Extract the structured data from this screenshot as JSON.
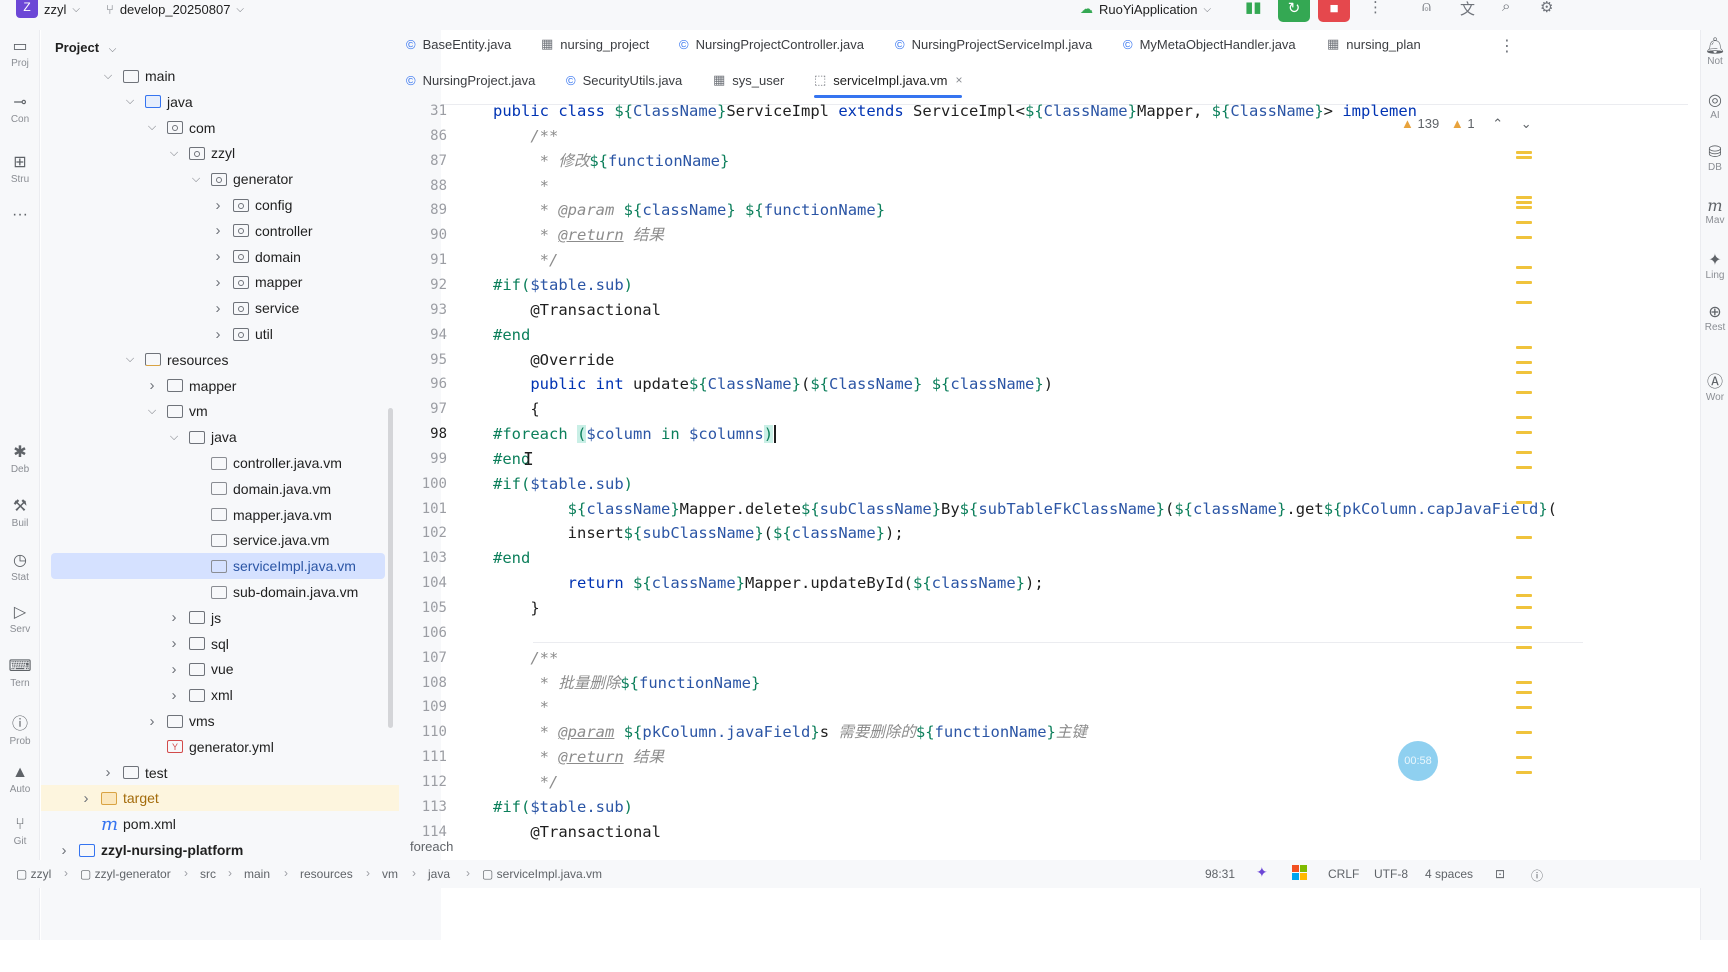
{
  "titlebar": {
    "project_badge": "Z",
    "project_name": "zzyl",
    "branch": "develop_20250807",
    "run_config": "RuoYiApplication",
    "colors": {
      "run_green": "#34a853",
      "stop_red": "#e5484d",
      "badge_purple": "#6c47d6"
    }
  },
  "left_strip": [
    {
      "icon": "folder-icon",
      "glyph": "▭",
      "label": "Proj"
    },
    {
      "icon": "commit-icon",
      "glyph": "⊸",
      "label": "Con"
    },
    {
      "icon": "structure-icon",
      "glyph": "⊞",
      "label": "Stru"
    },
    {
      "icon": "more-icon",
      "glyph": "···",
      "label": ""
    },
    {
      "icon": "debug-icon",
      "glyph": "✱",
      "label": "Deb"
    },
    {
      "icon": "build-icon",
      "glyph": "⚒",
      "label": "Buil"
    },
    {
      "icon": "stats-icon",
      "glyph": "◷",
      "label": "Stat"
    },
    {
      "icon": "services-icon",
      "glyph": "▷",
      "label": "Serv"
    },
    {
      "icon": "terminal-icon",
      "glyph": "⌨",
      "label": "Tern"
    },
    {
      "icon": "problems-icon",
      "glyph": "ⓘ",
      "label": "Prob"
    },
    {
      "icon": "warning-icon",
      "glyph": "▲",
      "label": "Auto"
    },
    {
      "icon": "git-icon",
      "glyph": "⑂",
      "label": "Git"
    }
  ],
  "project_panel": {
    "title": "Project",
    "tree": [
      {
        "label": "main",
        "type": "folder",
        "depth": 0,
        "expanded": true
      },
      {
        "label": "java",
        "type": "folder-blue",
        "depth": 1,
        "expanded": true
      },
      {
        "label": "com",
        "type": "package",
        "depth": 2,
        "expanded": true
      },
      {
        "label": "zzyl",
        "type": "package",
        "depth": 3,
        "expanded": true
      },
      {
        "label": "generator",
        "type": "package",
        "depth": 4,
        "expanded": true
      },
      {
        "label": "config",
        "type": "package",
        "depth": 5,
        "expanded": false
      },
      {
        "label": "controller",
        "type": "package",
        "depth": 5,
        "expanded": false
      },
      {
        "label": "domain",
        "type": "package",
        "depth": 5,
        "expanded": false
      },
      {
        "label": "mapper",
        "type": "package",
        "depth": 5,
        "expanded": false
      },
      {
        "label": "service",
        "type": "package",
        "depth": 5,
        "expanded": false
      },
      {
        "label": "util",
        "type": "package",
        "depth": 5,
        "expanded": false
      },
      {
        "label": "resources",
        "type": "folder-res",
        "depth": 1,
        "expanded": true
      },
      {
        "label": "mapper",
        "type": "folder",
        "depth": 2,
        "expanded": false
      },
      {
        "label": "vm",
        "type": "folder",
        "depth": 2,
        "expanded": true
      },
      {
        "label": "java",
        "type": "folder",
        "depth": 3,
        "expanded": true
      },
      {
        "label": "controller.java.vm",
        "type": "file",
        "depth": 4
      },
      {
        "label": "domain.java.vm",
        "type": "file",
        "depth": 4
      },
      {
        "label": "mapper.java.vm",
        "type": "file",
        "depth": 4
      },
      {
        "label": "service.java.vm",
        "type": "file",
        "depth": 4
      },
      {
        "label": "serviceImpl.java.vm",
        "type": "file",
        "depth": 4,
        "selected": true
      },
      {
        "label": "sub-domain.java.vm",
        "type": "file",
        "depth": 4
      },
      {
        "label": "js",
        "type": "folder",
        "depth": 3,
        "expanded": false
      },
      {
        "label": "sql",
        "type": "folder",
        "depth": 3,
        "expanded": false
      },
      {
        "label": "vue",
        "type": "folder",
        "depth": 3,
        "expanded": false
      },
      {
        "label": "xml",
        "type": "folder",
        "depth": 3,
        "expanded": false
      },
      {
        "label": "vms",
        "type": "folder",
        "depth": 2,
        "expanded": false
      },
      {
        "label": "generator.yml",
        "type": "yml",
        "depth": 2
      },
      {
        "label": "test",
        "type": "folder",
        "depth": 0,
        "expanded": false
      },
      {
        "label": "target",
        "type": "folder-orange",
        "depth": -1,
        "expanded": false,
        "highlight": true
      },
      {
        "label": "pom.xml",
        "type": "maven",
        "depth": -1
      },
      {
        "label": "zzyl-nursing-platform",
        "type": "module",
        "depth": -2,
        "expanded": false,
        "bold": true
      }
    ]
  },
  "tabs_row1": [
    {
      "label": "BaseEntity.java",
      "icon": "class-icon"
    },
    {
      "label": "nursing_project",
      "icon": "table-icon"
    },
    {
      "label": "NursingProjectController.java",
      "icon": "class-icon"
    },
    {
      "label": "NursingProjectServiceImpl.java",
      "icon": "class-icon"
    },
    {
      "label": "MyMetaObjectHandler.java",
      "icon": "class-icon"
    },
    {
      "label": "nursing_plan",
      "icon": "table-icon"
    }
  ],
  "tabs_row2": [
    {
      "label": "NursingProject.java",
      "icon": "class-icon"
    },
    {
      "label": "SecurityUtils.java",
      "icon": "class-icon"
    },
    {
      "label": "sys_user",
      "icon": "table-icon"
    },
    {
      "label": "serviceImpl.java.vm",
      "icon": "file-icon",
      "active": true
    }
  ],
  "editor": {
    "warnings": "139",
    "weak_warnings": "1",
    "current_line": "98",
    "lines": [
      {
        "n": "31",
        "html": "<span class='kw'>public class</span> <span class='vm'>${</span><span class='var'>ClassName</span><span class='vm'>}</span>ServiceImpl <span class='kw'>extends</span> ServiceImpl&lt;<span class='vm'>${</span><span class='var'>ClassName</span><span class='vm'>}</span>Mapper, <span class='vm'>${</span><span class='var'>ClassName</span><span class='vm'>}</span>&gt; <span class='kw'>implemen</span>"
      },
      {
        "n": "86",
        "html": "    <span class='cm'>/**</span>"
      },
      {
        "n": "87",
        "html": "     <span class='cm'>* 修改</span><span class='vm'>${</span><span class='var'>functionName</span><span class='vm'>}</span>"
      },
      {
        "n": "88",
        "html": "     <span class='cm'>*</span>"
      },
      {
        "n": "89",
        "html": "     <span class='cm'>* @param</span> <span class='vm'>${</span><span class='var'>className</span><span class='vm'>}</span> <span class='vm'>${</span><span class='var'>functionName</span><span class='vm'>}</span>"
      },
      {
        "n": "90",
        "html": "     <span class='cm'>* <u>@return</u> 结果</span>"
      },
      {
        "n": "91",
        "html": "     <span class='cm'>*/</span>"
      },
      {
        "n": "92",
        "html": "<span class='vm'>#if(</span><span class='var'>$table.sub</span><span class='vm'>)</span>"
      },
      {
        "n": "93",
        "html": "    @Transactional"
      },
      {
        "n": "94",
        "html": "<span class='vm'>#end</span>"
      },
      {
        "n": "95",
        "html": "    @Override"
      },
      {
        "n": "96",
        "html": "    <span class='kw'>public int</span> update<span class='vm'>${</span><span class='var'>ClassName</span><span class='vm'>}</span>(<span class='vm'>${</span><span class='var'>ClassName</span><span class='vm'>}</span> <span class='vm'>${</span><span class='var'>className</span><span class='vm'>}</span>)"
      },
      {
        "n": "97",
        "html": "    {"
      },
      {
        "n": "98",
        "html": "<span class='vm'>#foreach</span> <span class='hl vm'>(</span><span class='var'>$column</span> <span class='vm'>in</span> <span class='var'>$columns</span><span class='hl vm'>)</span>"
      },
      {
        "n": "99",
        "html": "<span class='vm'>#end</span>"
      },
      {
        "n": "100",
        "html": "<span class='vm'>#if(</span><span class='var'>$table.sub</span><span class='vm'>)</span>"
      },
      {
        "n": "101",
        "html": "        <span class='vm'>${</span><span class='var'>className</span><span class='vm'>}</span>Mapper.delete<span class='vm'>${</span><span class='var'>subClassName</span><span class='vm'>}</span>By<span class='vm'>${</span><span class='var'>subTableFkClassName</span><span class='vm'>}</span>(<span class='vm'>${</span><span class='var'>className</span><span class='vm'>}</span>.get<span class='vm'>${</span><span class='var'>pkColumn.capJavaField</span><span class='vm'>}</span>("
      },
      {
        "n": "102",
        "html": "        insert<span class='vm'>${</span><span class='var'>subClassName</span><span class='vm'>}</span>(<span class='vm'>${</span><span class='var'>className</span><span class='vm'>}</span>);"
      },
      {
        "n": "103",
        "html": "<span class='vm'>#end</span>"
      },
      {
        "n": "104",
        "html": "        <span class='kw'>return</span> <span class='vm'>${</span><span class='var'>className</span><span class='vm'>}</span>Mapper.updateById(<span class='vm'>${</span><span class='var'>className</span><span class='vm'>}</span>);"
      },
      {
        "n": "105",
        "html": "    }"
      },
      {
        "n": "106",
        "html": ""
      },
      {
        "n": "107",
        "html": "    <span class='cm'>/**</span>"
      },
      {
        "n": "108",
        "html": "     <span class='cm'>* 批量删除</span><span class='vm'>${</span><span class='var'>functionName</span><span class='vm'>}</span>"
      },
      {
        "n": "109",
        "html": "     <span class='cm'>*</span>"
      },
      {
        "n": "110",
        "html": "     <span class='cm'>* <u>@param</u></span> <span class='vm'>${</span><span class='var'>pkColumn.javaField</span><span class='vm'>}</span>s <span class='cm'>需要删除的</span><span class='vm'>${</span><span class='var'>functionName</span><span class='vm'>}</span><span class='cm'>主键</span>"
      },
      {
        "n": "111",
        "html": "     <span class='cm'>* <u>@return</u> 结果</span>"
      },
      {
        "n": "112",
        "html": "     <span class='cm'>*/</span>"
      },
      {
        "n": "113",
        "html": "<span class='vm'>#if(</span><span class='var'>$table.sub</span><span class='vm'>)</span>"
      },
      {
        "n": "114",
        "html": "    @Transactional"
      }
    ],
    "breadcrumb_hint": "foreach",
    "timer": "00:58"
  },
  "right_strip": [
    {
      "icon": "notifications-icon",
      "glyph": "🔔︎",
      "label": "Not"
    },
    {
      "icon": "ai-icon",
      "glyph": "◎",
      "label": "AI"
    },
    {
      "icon": "database-icon",
      "glyph": "⛁",
      "label": "DB"
    },
    {
      "icon": "maven-icon",
      "glyph": "m",
      "label": "Mav"
    },
    {
      "icon": "lingma-icon",
      "glyph": "✦",
      "label": "Ling"
    },
    {
      "icon": "rest-icon",
      "glyph": "⊕",
      "label": "Rest"
    },
    {
      "icon": "word-icon",
      "glyph": "Ⓐ",
      "label": "Wor"
    }
  ],
  "statusbar": {
    "crumbs": [
      "zzyl",
      "zzyl-generator",
      "src",
      "main",
      "resources",
      "vm",
      "java",
      "serviceImpl.java.vm"
    ],
    "position": "98:31",
    "line_ending": "CRLF",
    "encoding": "UTF-8",
    "indent": "4 spaces"
  }
}
